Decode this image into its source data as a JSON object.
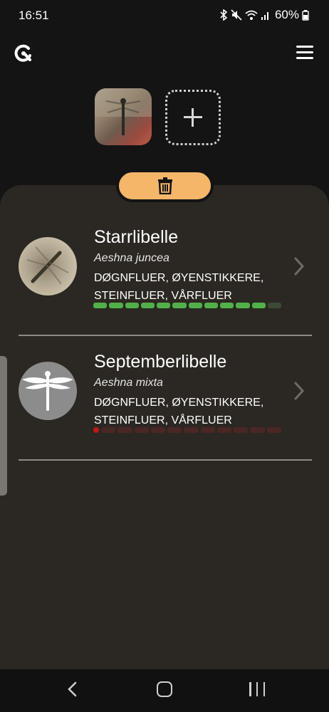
{
  "status_bar": {
    "time": "16:51",
    "battery": "60%"
  },
  "app_bar": {
    "logo_icon": "circular-logo-icon",
    "menu_icon": "hamburger-menu-icon"
  },
  "photos": {
    "thumbnail_icon": "dragonfly-photo",
    "add_icon": "plus-icon"
  },
  "delete_button": {
    "icon": "trash-icon",
    "color": "#f5b66a"
  },
  "results": [
    {
      "title": "Starrlibelle",
      "latin": "Aeshna juncea",
      "group": "DØGNFLUER, ØYENSTIKKERE, STEINFLUER, VÅRFLUER",
      "confidence": 0.92,
      "bar_color": "#52b04a"
    },
    {
      "title": "Septemberlibelle",
      "latin": "Aeshna mixta",
      "group": "DØGNFLUER, ØYENSTIKKERE, STEINFLUER, VÅRFLUER",
      "confidence": 0.02,
      "bar_color": "#c21717"
    }
  ],
  "nav_bar": {
    "back_icon": "back-chevron-icon",
    "home_icon": "home-icon",
    "recents_icon": "recents-icon"
  }
}
